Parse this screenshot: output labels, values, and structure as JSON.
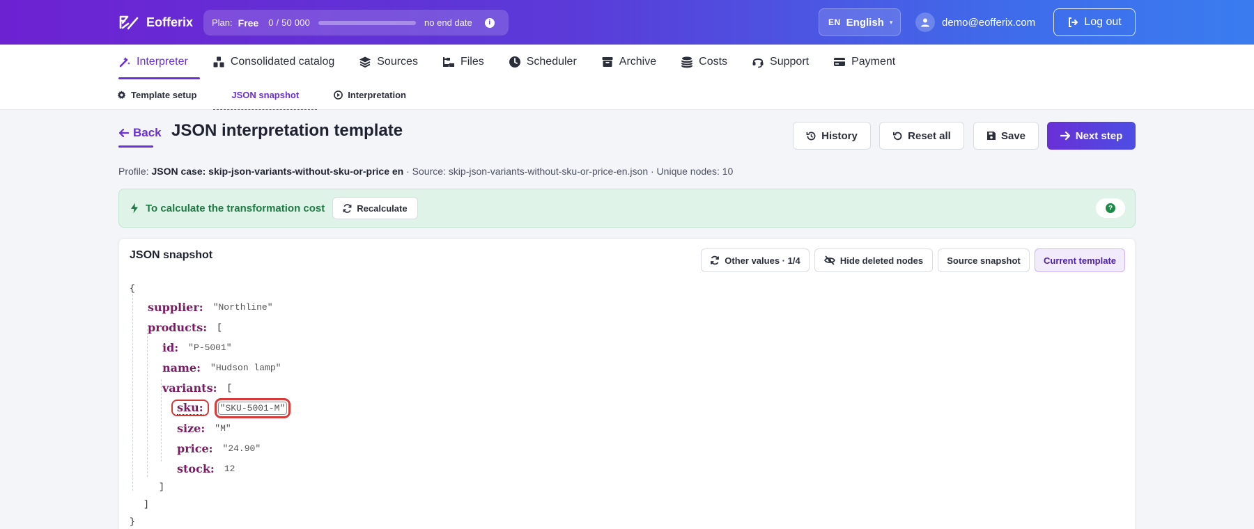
{
  "brand": {
    "name": "Eofferix"
  },
  "plan": {
    "label": "Plan:",
    "value": "Free",
    "usage_text": "0 / 50 000",
    "usage_fraction": 0,
    "end_text": "no end date",
    "info_glyph": "i"
  },
  "language": {
    "code": "EN",
    "name": "English",
    "caret": "▾"
  },
  "user": {
    "email": "demo@eofferix.com"
  },
  "logout_label": "Log out",
  "nav": {
    "items": [
      {
        "label": "Interpreter",
        "icon": "wand-icon"
      },
      {
        "label": "Consolidated catalog",
        "icon": "catalog-icon"
      },
      {
        "label": "Sources",
        "icon": "layers-icon"
      },
      {
        "label": "Files",
        "icon": "files-icon"
      },
      {
        "label": "Scheduler",
        "icon": "clock-icon"
      },
      {
        "label": "Archive",
        "icon": "archive-icon"
      },
      {
        "label": "Costs",
        "icon": "coins-icon"
      },
      {
        "label": "Support",
        "icon": "headset-icon"
      },
      {
        "label": "Payment",
        "icon": "card-icon"
      }
    ],
    "active_index": 0
  },
  "subnav": {
    "items": [
      {
        "label": "Template setup",
        "icon": "gear-icon"
      },
      {
        "label": "JSON snapshot",
        "icon": ""
      },
      {
        "label": "Interpretation",
        "icon": "play-icon"
      }
    ],
    "active_index": 1
  },
  "header": {
    "back_label": "Back",
    "title": "JSON interpretation template",
    "history_label": "History",
    "reset_label": "Reset all",
    "save_label": "Save",
    "next_label": "Next step"
  },
  "profile": {
    "prefix": "Profile:",
    "name": "JSON case: skip-json-variants-without-sku-or-price en",
    "source_text": "· Source: skip-json-variants-without-sku-or-price-en.json · Unique nodes: 10"
  },
  "banner": {
    "text": "To calculate the transformation cost",
    "recalc_label": "Recalculate",
    "help_glyph": "?",
    "color": "#1e7a43"
  },
  "snapshot": {
    "title": "JSON snapshot",
    "other_values_label": "Other values · 1/4",
    "hide_deleted_label": "Hide deleted nodes",
    "source_snapshot_label": "Source snapshot",
    "current_template_label": "Current template",
    "json": {
      "open_brace": "{",
      "close_brace": "}",
      "supplier_key": "supplier:",
      "supplier_value": "\"Northline\"",
      "products_key": "products:",
      "open_bracket": "[",
      "close_bracket": "]",
      "id_key": "id:",
      "id_value": "\"P-5001\"",
      "name_key": "name:",
      "name_value": "\"Hudson lamp\"",
      "variants_key": "variants:",
      "sku_key": "sku:",
      "sku_value": "\"SKU-5001-M\"",
      "size_key": "size:",
      "size_value": "\"M\"",
      "price_key": "price:",
      "price_value": "\"24.90\"",
      "stock_key": "stock:",
      "stock_value": "12"
    }
  },
  "colors": {
    "accent": "#6a2fd6",
    "highlight": "#d83a3a",
    "json_key": "#7a1b63"
  }
}
